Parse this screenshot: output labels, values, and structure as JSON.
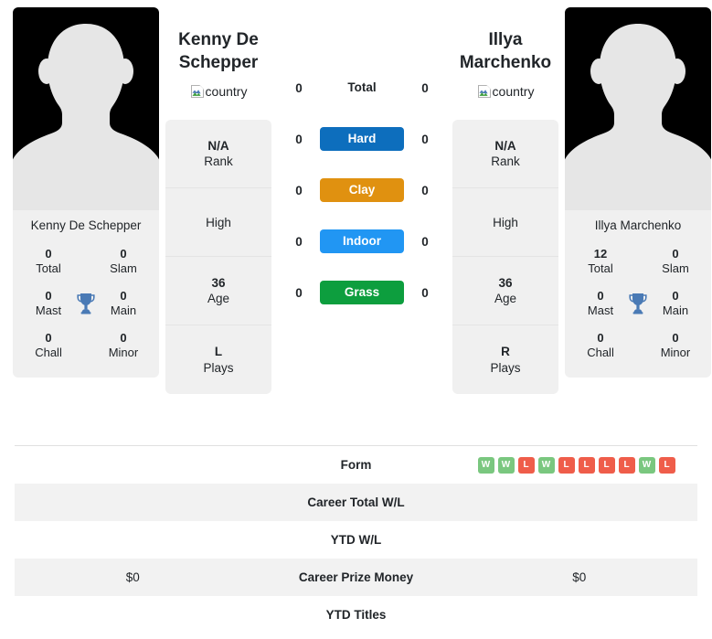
{
  "players": {
    "left": {
      "display_name": "Kenny De Schepper",
      "title_line1": "Kenny De",
      "title_line2": "Schepper",
      "country_alt": "country",
      "titles": {
        "total_value": "0",
        "total_label": "Total",
        "slam_value": "0",
        "slam_label": "Slam",
        "mast_value": "0",
        "mast_label": "Mast",
        "main_value": "0",
        "main_label": "Main",
        "chall_value": "0",
        "chall_label": "Chall",
        "minor_value": "0",
        "minor_label": "Minor"
      },
      "info": {
        "rank_value": "N/A",
        "rank_label": "Rank",
        "high_value": "",
        "high_label": "High",
        "age_value": "36",
        "age_label": "Age",
        "plays_value": "L",
        "plays_label": "Plays"
      },
      "surface_counts": {
        "total": "0",
        "hard": "0",
        "clay": "0",
        "indoor": "0",
        "grass": "0"
      },
      "career_prize_money": "$0"
    },
    "right": {
      "display_name": "Illya Marchenko",
      "title_line1": "Illya",
      "title_line2": "Marchenko",
      "country_alt": "country",
      "titles": {
        "total_value": "12",
        "total_label": "Total",
        "slam_value": "0",
        "slam_label": "Slam",
        "mast_value": "0",
        "mast_label": "Mast",
        "main_value": "0",
        "main_label": "Main",
        "chall_value": "0",
        "chall_label": "Chall",
        "minor_value": "0",
        "minor_label": "Minor"
      },
      "info": {
        "rank_value": "N/A",
        "rank_label": "Rank",
        "high_value": "",
        "high_label": "High",
        "age_value": "36",
        "age_label": "Age",
        "plays_value": "R",
        "plays_label": "Plays"
      },
      "surface_counts": {
        "total": "0",
        "hard": "0",
        "clay": "0",
        "indoor": "0",
        "grass": "0"
      },
      "career_prize_money": "$0"
    }
  },
  "surfaces": [
    {
      "key": "total",
      "label": "Total",
      "color": "transparent",
      "text_color": "#212529"
    },
    {
      "key": "hard",
      "label": "Hard",
      "color": "#0d6ebd",
      "text_color": "#ffffff"
    },
    {
      "key": "clay",
      "label": "Clay",
      "color": "#e09110",
      "text_color": "#ffffff"
    },
    {
      "key": "indoor",
      "label": "Indoor",
      "color": "#2196f3",
      "text_color": "#ffffff"
    },
    {
      "key": "grass",
      "label": "Grass",
      "color": "#0d9e3e",
      "text_color": "#ffffff"
    }
  ],
  "table": {
    "rows": [
      {
        "label": "Form",
        "left": "",
        "right": ""
      },
      {
        "label": "Career Total W/L",
        "left": "",
        "right": ""
      },
      {
        "label": "YTD W/L",
        "left": "",
        "right": ""
      },
      {
        "label": "Career Prize Money",
        "left": "$0",
        "right": "$0"
      },
      {
        "label": "YTD Titles",
        "left": "",
        "right": ""
      }
    ]
  },
  "form": {
    "results": [
      "W",
      "W",
      "L",
      "W",
      "L",
      "L",
      "L",
      "L",
      "W",
      "L"
    ],
    "win_color": "#7ac77f",
    "loss_color": "#ef5d4a"
  },
  "colors": {
    "card_background": "#f0f0f0",
    "row_stripe": "#f2f2f2",
    "trophy": "#4a7ab5",
    "avatar_background": "#000000",
    "silhouette": "#e6e6e6"
  }
}
